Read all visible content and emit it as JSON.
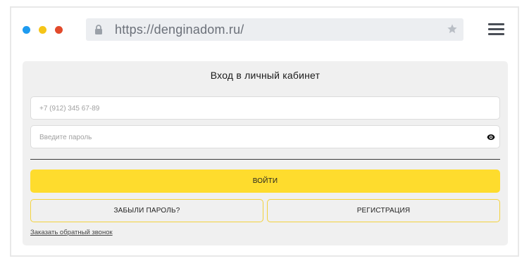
{
  "browser": {
    "url": "https://denginadom.ru/",
    "traffic_light_colors": [
      "#1e9bf0",
      "#f5c518",
      "#e24a2b"
    ]
  },
  "login_form": {
    "title": "Вход в личный кабинет",
    "phone_placeholder": "+7 (912) 345 67-89",
    "password_placeholder": "Введите пароль",
    "login_button": "ВОЙТИ",
    "forgot_button": "ЗАБЫЛИ ПАРОЛЬ?",
    "register_button": "РЕГИСТРАЦИЯ",
    "callback_link": "Заказать обратный звонок"
  },
  "colors": {
    "accent": "#fedc2d",
    "card_background": "#f0f0f0",
    "outline_accent": "#f3d23e"
  },
  "icons": [
    "lock-icon",
    "star-icon",
    "menu-icon",
    "eye-icon"
  ]
}
